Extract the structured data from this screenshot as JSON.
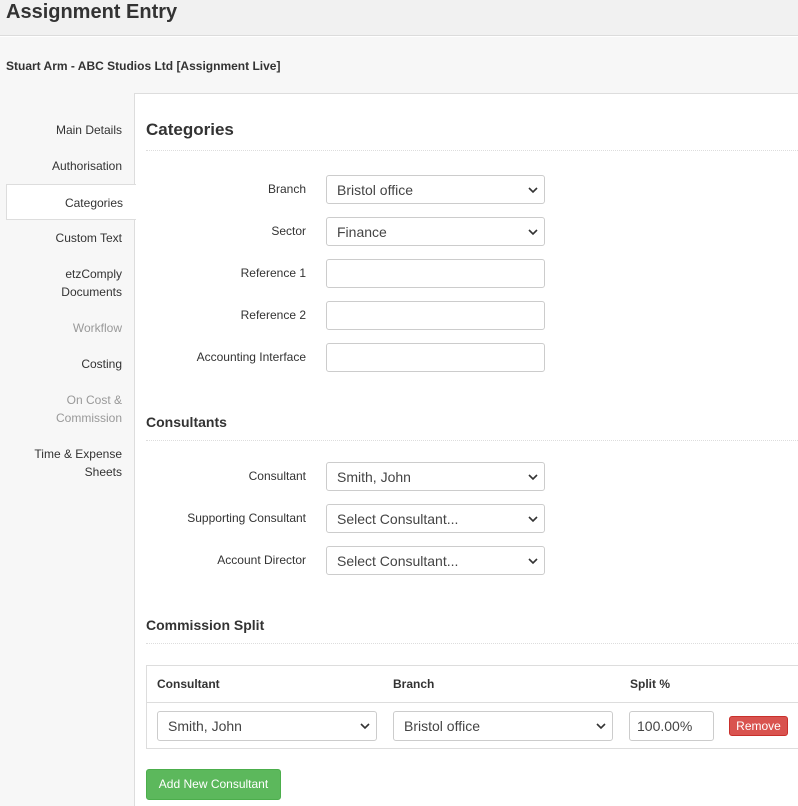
{
  "page": {
    "title": "Assignment Entry",
    "record_title": "Stuart Arm - ABC Studios Ltd [Assignment Live]"
  },
  "sidebar": {
    "items": [
      {
        "label": "Main Details",
        "state": "normal"
      },
      {
        "label": "Authorisation",
        "state": "normal"
      },
      {
        "label": "Categories",
        "state": "active"
      },
      {
        "label": "Custom Text",
        "state": "normal"
      },
      {
        "label": "etzComply\nDocuments",
        "state": "normal"
      },
      {
        "label": "Workflow",
        "state": "disabled"
      },
      {
        "label": "Costing",
        "state": "normal"
      },
      {
        "label": "On Cost &\nCommission",
        "state": "disabled"
      },
      {
        "label": "Time & Expense\nSheets",
        "state": "normal"
      }
    ]
  },
  "categories": {
    "heading": "Categories",
    "branch": {
      "label": "Branch",
      "value": "Bristol office"
    },
    "sector": {
      "label": "Sector",
      "value": "Finance"
    },
    "reference1": {
      "label": "Reference 1",
      "value": ""
    },
    "reference2": {
      "label": "Reference 2",
      "value": ""
    },
    "accounting": {
      "label": "Accounting Interface",
      "value": ""
    }
  },
  "consultants": {
    "heading": "Consultants",
    "consultant": {
      "label": "Consultant",
      "value": "Smith, John"
    },
    "supporting": {
      "label": "Supporting Consultant",
      "value": "Select Consultant..."
    },
    "director": {
      "label": "Account Director",
      "value": "Select Consultant..."
    }
  },
  "commission": {
    "heading": "Commission Split",
    "columns": {
      "consultant": "Consultant",
      "branch": "Branch",
      "split": "Split %"
    },
    "rows": [
      {
        "consultant": "Smith, John",
        "branch": "Bristol office",
        "split": "100.00%"
      }
    ],
    "remove_label": "Remove",
    "add_label": "Add New Consultant"
  },
  "colors": {
    "remove_button": "#d9534f",
    "add_button": "#5cb85c",
    "header_bg": "#f1f1f1"
  }
}
